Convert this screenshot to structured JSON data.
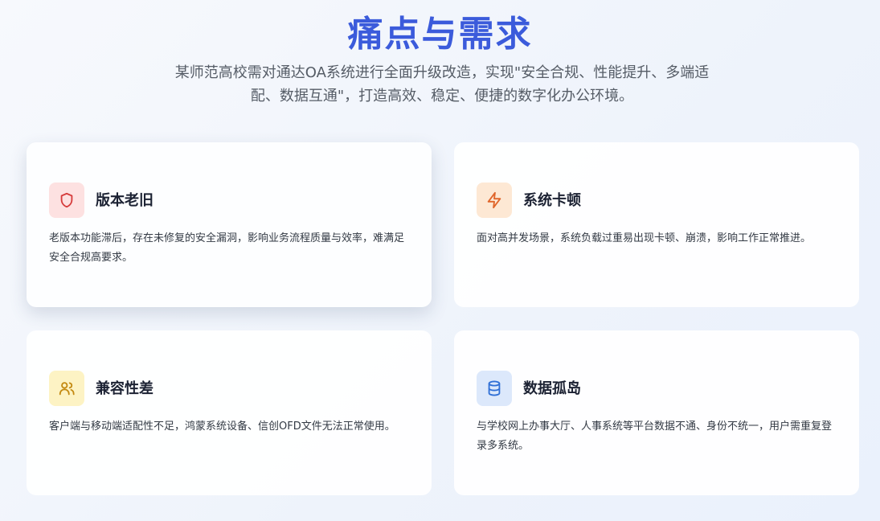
{
  "header": {
    "title": "痛点与需求",
    "subtitle": "某师范高校需对通达OA系统进行全面升级改造，实现\"安全合规、性能提升、多端适配、数据互通\"，打造高效、稳定、便捷的数字化办公环境。"
  },
  "cards": [
    {
      "title": "版本老旧",
      "description": "老版本功能滞后，存在未修复的安全漏洞，影响业务流程质量与效率，难满足安全合规高要求。",
      "icon": "shield-icon",
      "icon_color": "#d63c3c",
      "icon_bg": "#fde1e1"
    },
    {
      "title": "系统卡顿",
      "description": "面对高并发场景，系统负载过重易出现卡顿、崩溃，影响工作正常推进。",
      "icon": "lightning-icon",
      "icon_color": "#e0652a",
      "icon_bg": "#fde8d4"
    },
    {
      "title": "兼容性差",
      "description": "客户端与移动端适配性不足，鸿蒙系统设备、信创OFD文件无法正常使用。",
      "icon": "users-icon",
      "icon_color": "#c48a12",
      "icon_bg": "#fdf3c4"
    },
    {
      "title": "数据孤岛",
      "description": "与学校网上办事大厅、人事系统等平台数据不通、身份不统一，用户需重复登录多系统。",
      "icon": "database-icon",
      "icon_color": "#2f6fd6",
      "icon_bg": "#dce8fb"
    }
  ]
}
